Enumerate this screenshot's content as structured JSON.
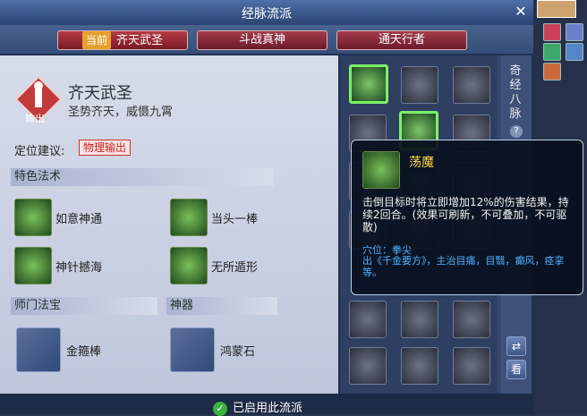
{
  "window": {
    "title": "经脉流派"
  },
  "tabs": [
    {
      "current": "当前",
      "label": "齐天武圣"
    },
    {
      "label": "斗战真神"
    },
    {
      "label": "通天行者"
    }
  ],
  "school": {
    "badge_text": "输出",
    "name": "齐天武圣",
    "desc": "圣势齐天，威慑九霄",
    "position_label": "定位建议:",
    "position_value": "物理输出"
  },
  "features": {
    "header": "特色法术",
    "skills": [
      {
        "name": "如意神通"
      },
      {
        "name": "当头一棒"
      },
      {
        "name": "神针撼海"
      },
      {
        "name": "无所遁形"
      }
    ]
  },
  "treasure": {
    "header": "师门法宝",
    "name": "金箍棒"
  },
  "artifact": {
    "header": "神器",
    "name": "鸿蒙石"
  },
  "meridian": {
    "label": "奇经八脉",
    "help": "?"
  },
  "tooltip": {
    "name": "荡魔",
    "desc": "击倒目标时将立即增加12%的伤害结果，持续2回合。(效果可刷新，不可叠加，不可驱散)",
    "point": "穴位：拳尖",
    "source": "出《千金要方》，主治目痛，目翳，癫风，痉挛等。"
  },
  "side_buttons": {
    "swap": "⇄",
    "view": "看"
  },
  "footer": {
    "check": "✓",
    "enabled": "已启用此流派"
  }
}
